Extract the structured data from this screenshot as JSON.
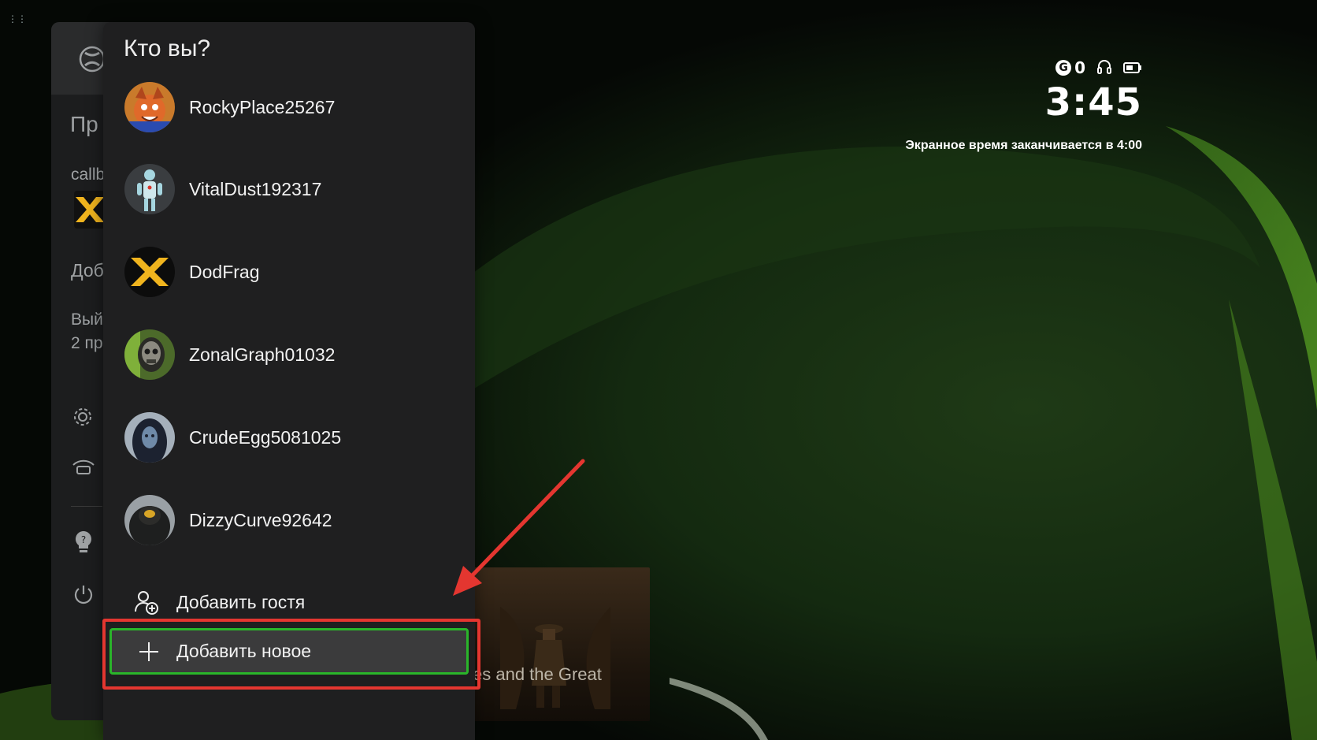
{
  "status": {
    "gamerscore": "0",
    "time": "3:45",
    "screen_time_notice": "Экранное время заканчивается в 4:00"
  },
  "guide": {
    "section_title_partial": "Пр",
    "gamertag_partial": "callb",
    "add_partial": "Доб",
    "signout_partial_line1": "Вый",
    "signout_partial_line2": "2 пр"
  },
  "chooser": {
    "title": "Кто вы?",
    "accounts": [
      {
        "name": "RockyPlace25267"
      },
      {
        "name": "VitalDust192317"
      },
      {
        "name": "DodFrag"
      },
      {
        "name": "ZonalGraph01032"
      },
      {
        "name": "CrudeEgg5081025"
      },
      {
        "name": "DizzyCurve92642"
      }
    ],
    "add_guest_label": "Добавить гостя",
    "add_new_label": "Добавить новое"
  },
  "background_tile": {
    "title_partial": "es and the Great"
  },
  "colors": {
    "focus_green": "#2ab52a",
    "annotation_red": "#e43630",
    "panel_bg": "#1f1f20"
  }
}
